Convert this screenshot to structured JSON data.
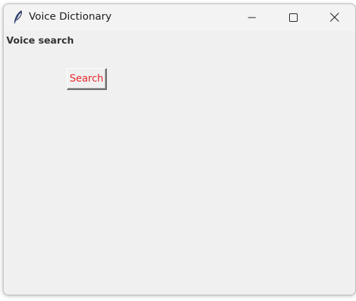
{
  "window": {
    "title": "Voice Dictionary",
    "app_icon": "feather-icon"
  },
  "titlebar_controls": {
    "minimize_icon": "minimize-icon",
    "maximize_icon": "maximize-icon",
    "close_icon": "close-icon"
  },
  "main": {
    "voice_label": "Voice search",
    "search_button_label": "Search",
    "search_button_color": "#e8262b"
  }
}
